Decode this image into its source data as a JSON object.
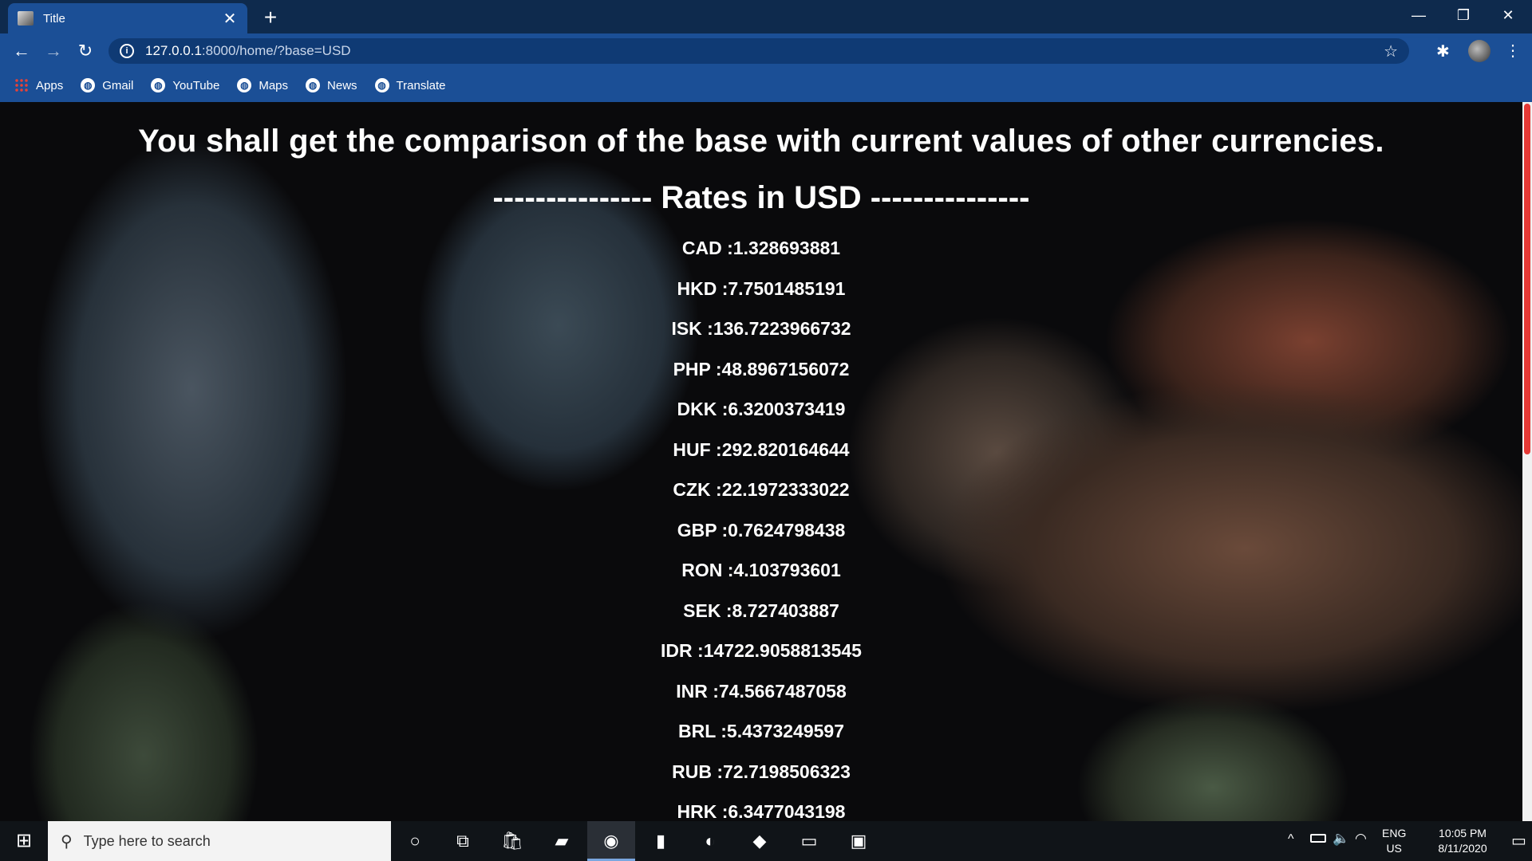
{
  "browser": {
    "tab_title": "Title",
    "new_tab_symbol": "+",
    "url_host": "127.0.0.1",
    "url_path": ":8000/home/?base=USD",
    "bookmarks": [
      "Apps",
      "Gmail",
      "YouTube",
      "Maps",
      "News",
      "Translate"
    ]
  },
  "page": {
    "headline": "You shall get the comparison of the base with current values of other currencies.",
    "subhead": "--------------- Rates in USD ---------------",
    "rates": [
      "CAD :1.328693881",
      "HKD :7.7501485191",
      "ISK :136.7223966732",
      "PHP :48.8967156072",
      "DKK :6.3200373419",
      "HUF :292.820164644",
      "CZK :22.1972333022",
      "GBP :0.7624798438",
      "RON :4.103793601",
      "SEK :8.727403887",
      "IDR :14722.9058813545",
      "INR :74.5667487058",
      "BRL :5.4373249597",
      "RUB :72.7198506323",
      "HRK :6.3477043198"
    ]
  },
  "taskbar": {
    "search_placeholder": "Type here to search",
    "lang_line1": "ENG",
    "lang_line2": "US",
    "time": "10:05 PM",
    "date": "8/11/2020"
  },
  "colors": {
    "tab_bar": "#0e2a4d",
    "toolbar": "#1b4f96",
    "scroll_thumb": "#e53935"
  }
}
